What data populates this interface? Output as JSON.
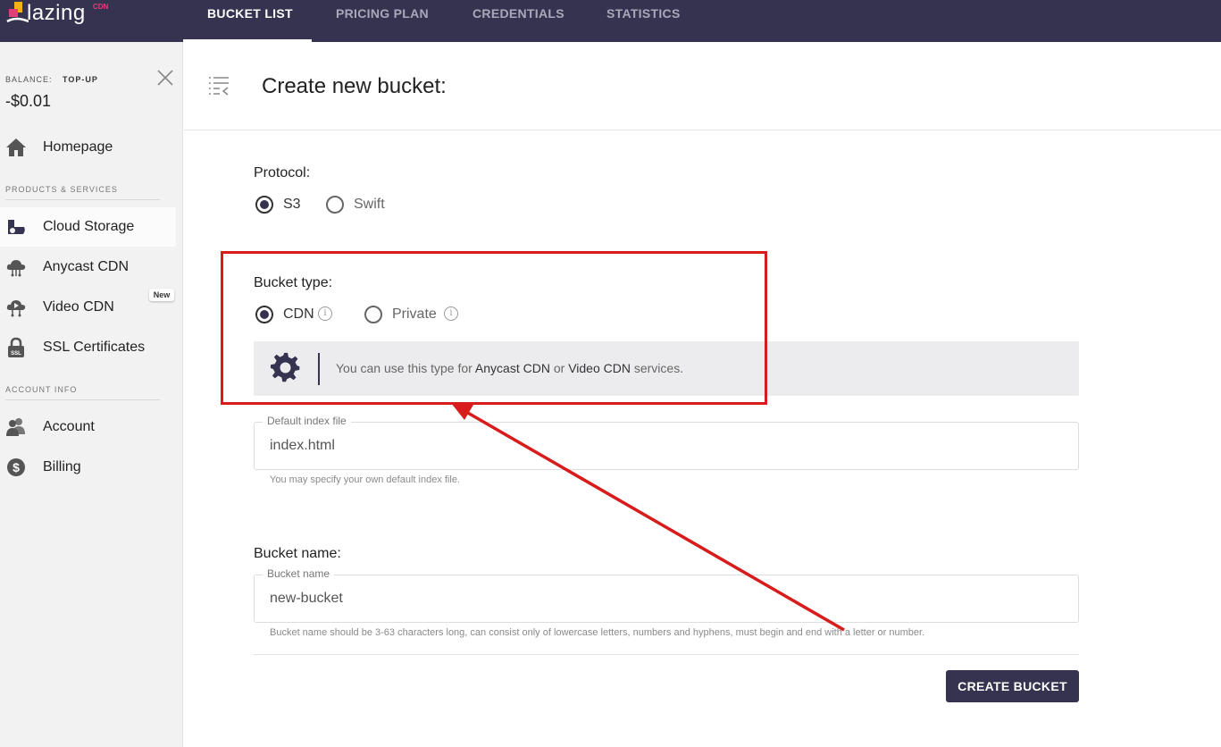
{
  "brand": {
    "name": "lazing",
    "sup": "CDN"
  },
  "nav": {
    "tabs": [
      {
        "label": "BUCKET LIST",
        "active": true
      },
      {
        "label": "PRICING PLAN",
        "active": false
      },
      {
        "label": "CREDENTIALS",
        "active": false
      },
      {
        "label": "STATISTICS",
        "active": false
      }
    ]
  },
  "sidebar": {
    "balance_label": "BALANCE:",
    "topup_label": "TOP-UP",
    "balance_value": "-$0.01",
    "homepage": "Homepage",
    "section_products": "PRODUCTS & SERVICES",
    "items": [
      {
        "label": "Cloud Storage",
        "icon": "cloud-storage-icon",
        "active": true
      },
      {
        "label": "Anycast CDN",
        "icon": "cloud-network-icon"
      },
      {
        "label": "Video CDN",
        "icon": "video-cloud-icon",
        "badge": "New"
      },
      {
        "label": "SSL Certificates",
        "icon": "lock-icon"
      }
    ],
    "section_account": "ACCOUNT INFO",
    "account_items": [
      {
        "label": "Account",
        "icon": "users-icon"
      },
      {
        "label": "Billing",
        "icon": "dollar-icon"
      }
    ]
  },
  "main": {
    "title": "Create new bucket:",
    "protocol": {
      "label": "Protocol:",
      "options": [
        {
          "label": "S3",
          "checked": true
        },
        {
          "label": "Swift",
          "checked": false
        }
      ]
    },
    "bucket_type": {
      "label": "Bucket type:",
      "options": [
        {
          "label": "CDN",
          "checked": true
        },
        {
          "label": "Private",
          "checked": false
        }
      ],
      "info_glyph": "i",
      "notice_prefix": "You can use this type for ",
      "notice_link1": "Anycast CDN",
      "notice_mid": " or ",
      "notice_link2": "Video CDN",
      "notice_suffix": " services."
    },
    "index_file": {
      "legend": "Default index file",
      "value": "index.html",
      "hint": "You may specify your own default index file."
    },
    "bucket_name": {
      "label": "Bucket name:",
      "legend": "Bucket name",
      "value": "new-bucket",
      "hint": "Bucket name should be 3-63 characters long, can consist only of lowercase letters, numbers and hyphens, must begin and end with a letter or number."
    },
    "create_button": "CREATE BUCKET"
  },
  "annotation": {
    "color": "#d81b1b"
  },
  "colors": {
    "brand_dark": "#35334f",
    "accent_pink": "#e0407a"
  }
}
